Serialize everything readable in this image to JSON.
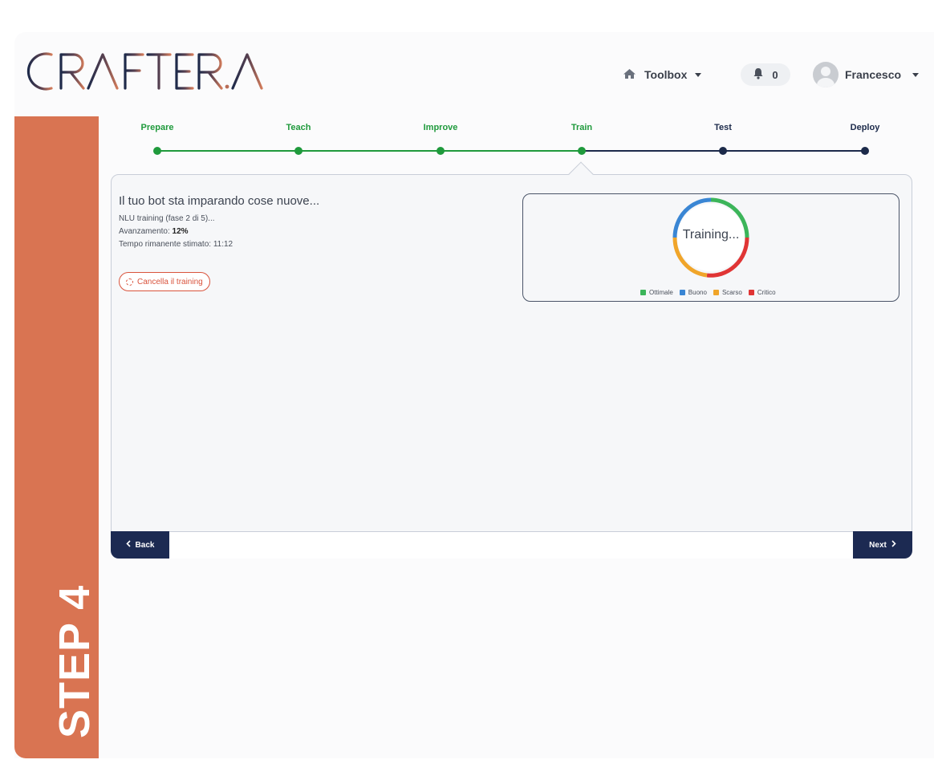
{
  "brand": {
    "logo_text": "CRAFTER.AI"
  },
  "header": {
    "toolbox_label": "Toolbox",
    "notification_count": "0",
    "user_name": "Francesco"
  },
  "sidebar": {
    "step_label": "STEP 4"
  },
  "stepper": {
    "steps": [
      {
        "label": "Prepare",
        "status": "done"
      },
      {
        "label": "Teach",
        "status": "done"
      },
      {
        "label": "Improve",
        "status": "done"
      },
      {
        "label": "Train",
        "status": "current"
      },
      {
        "label": "Test",
        "status": "todo"
      },
      {
        "label": "Deploy",
        "status": "todo"
      }
    ],
    "colors": {
      "done": "#1f9a3c",
      "todo": "#1c2a4a"
    }
  },
  "training": {
    "heading": "Il tuo bot sta imparando cose nuove...",
    "phase_text": "NLU training (fase 2 di 5)...",
    "progress_label": "Avanzamento:",
    "progress_value": "12%",
    "remaining_text": "Tempo rimanente stimato: 11:12",
    "cancel_label": "Cancella il training",
    "status_text": "Training..."
  },
  "legend": [
    {
      "label": "Ottimale",
      "color": "#3cb55a"
    },
    {
      "label": "Buono",
      "color": "#3a86d4"
    },
    {
      "label": "Scarso",
      "color": "#f0a52a"
    },
    {
      "label": "Critico",
      "color": "#e03535"
    }
  ],
  "footer": {
    "back_label": "Back",
    "next_label": "Next"
  },
  "colors": {
    "accent": "#d97452",
    "navy": "#1c2a52"
  }
}
